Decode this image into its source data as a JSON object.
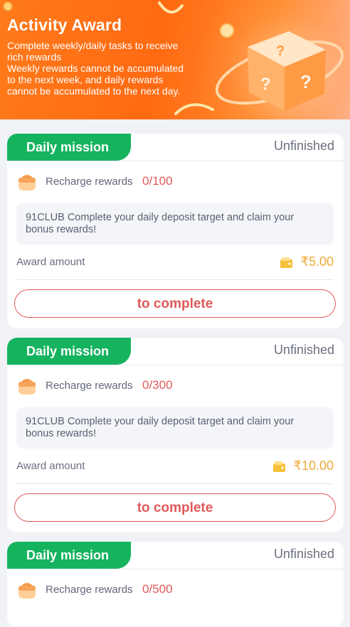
{
  "banner": {
    "title": "Activity Award",
    "desc_lines": [
      "Complete weekly/daily tasks to receive",
      "rich rewards",
      "Weekly rewards cannot be accumulated",
      "to the next week, and daily rewards",
      "cannot be accumulated to the next day."
    ]
  },
  "missions": [
    {
      "tab": "Daily mission",
      "status": "Unfinished",
      "task_label": "Recharge rewards",
      "progress": "0/100",
      "description_lines": [
        "91CLUB Complete your daily deposit target and claim your",
        "bonus rewards!"
      ],
      "award_label": "Award amount",
      "award_amount": "₹5.00",
      "button": "to complete"
    },
    {
      "tab": "Daily mission",
      "status": "Unfinished",
      "task_label": "Recharge rewards",
      "progress": "0/300",
      "description_lines": [
        "91CLUB Complete your daily deposit target and claim your",
        "bonus rewards!"
      ],
      "award_label": "Award amount",
      "award_amount": "₹10.00",
      "button": "to complete"
    },
    {
      "tab": "Daily mission",
      "status": "Unfinished",
      "task_label": "Recharge rewards",
      "progress": "0/500"
    }
  ],
  "colors": {
    "accent_green": "#16b35f",
    "accent_red": "#e05a5a",
    "award_gold": "#f0a93a",
    "banner_orange": "#ff6a12"
  },
  "icons": [
    "gift-box-icon",
    "wallet-icon",
    "lucky-cube-icon"
  ]
}
